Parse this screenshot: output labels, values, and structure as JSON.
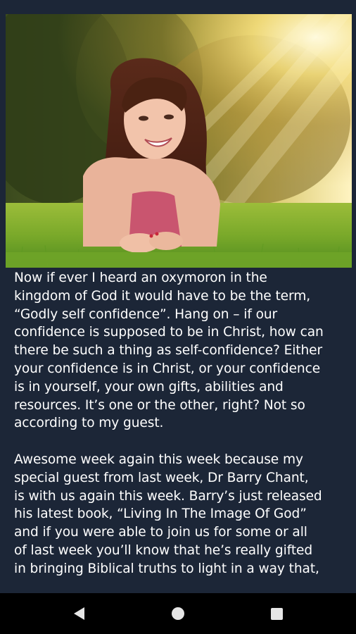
{
  "hero": {
    "alt": "Young woman lying on grass in sunlight"
  },
  "article": {
    "paragraphs": [
      " Now if ever I heard an oxymoron in the\nkingdom of God it would have to be the term,\n“Godly self confidence”. Hang on – if our\nconfidence is supposed to be in Christ, how can\nthere be such a thing as self-confidence? Either\nyour confidence is in Christ, or your confidence\nis in yourself, your own gifts, abilities and\nresources. It’s one or the other, right? Not so\naccording to my guest.",
      "Awesome week again this week because my\nspecial guest from last week, Dr Barry Chant,\nis with us again this week. Barry’s just released\nhis latest book, “Living In The Image Of God”\nand if you were able to join us for some or all\nof last week you’ll know that he’s really gifted\nin bringing Biblical truths to light in a way that,"
    ]
  },
  "navbar": {
    "back_icon": "back-triangle-icon",
    "home_icon": "home-circle-icon",
    "recents_icon": "recents-square-icon"
  },
  "colors": {
    "background": "#1c2637",
    "text": "#ffffff",
    "navbar": "#000000",
    "nav_icon": "#e6e6e6"
  }
}
